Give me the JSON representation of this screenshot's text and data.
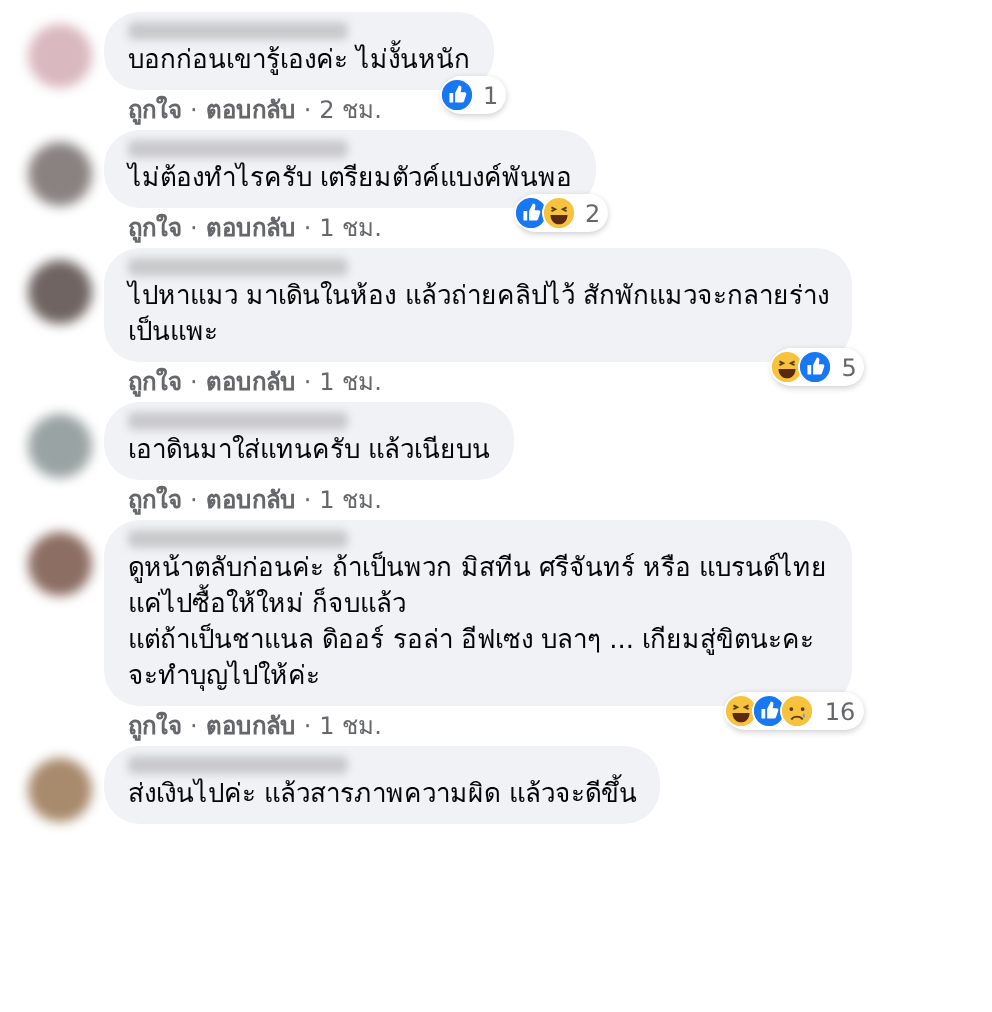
{
  "separator": "·",
  "comments": [
    {
      "avatar": {
        "color": "#d9b8bf"
      },
      "text": "บอกก่อนเขารู้เองค่ะ ไม่งั้นหนัก",
      "reactions": {
        "items": [
          {
            "kind": "like"
          }
        ],
        "count": "1"
      },
      "actions": {
        "like": "ถูกใจ",
        "reply": "ตอบกลับ",
        "time": "2 ชม."
      }
    },
    {
      "avatar": {
        "color": "#8a8280"
      },
      "text": "ไม่ต้องทำไรครับ เตรียมตัวค์แบงค์พันพอ",
      "reactions": {
        "items": [
          {
            "kind": "like"
          },
          {
            "kind": "haha"
          }
        ],
        "count": "2"
      },
      "actions": {
        "like": "ถูกใจ",
        "reply": "ตอบกลับ",
        "time": "1 ชม."
      }
    },
    {
      "avatar": {
        "color": "#6f6462"
      },
      "text": "ไปหาแมว มาเดินในห้อง แล้วถ่ายคลิปไว้ สักพักแมวจะกลายร่าง\nเป็นแพะ",
      "reactions": {
        "items": [
          {
            "kind": "haha"
          },
          {
            "kind": "like"
          }
        ],
        "count": "5"
      },
      "actions": {
        "like": "ถูกใจ",
        "reply": "ตอบกลับ",
        "time": "1 ชม."
      }
    },
    {
      "avatar": {
        "color": "#9aa3a3"
      },
      "text": "เอาดินมาใส่แทนครับ แล้วเนียบน",
      "actions": {
        "like": "ถูกใจ",
        "reply": "ตอบกลับ",
        "time": "1 ชม."
      }
    },
    {
      "avatar": {
        "color": "#8c6e63"
      },
      "text": "ดูหน้าตลับก่อนค่ะ ถ้าเป็นพวก มิสทีน ศรีจันทร์ หรือ แบรนด์ไทย\nแค่ไปซื้อให้ใหม่ ก็จบแล้ว\nแต่ถ้าเป็นชาแนล ดิออร์ รอล่า อีฟเซง บลาๆ ... เกียมสู่ขิตนะคะ\nจะทำบุญไปให้ค่ะ",
      "reactions": {
        "items": [
          {
            "kind": "haha"
          },
          {
            "kind": "like"
          },
          {
            "kind": "sad"
          }
        ],
        "count": "16"
      },
      "actions": {
        "like": "ถูกใจ",
        "reply": "ตอบกลับ",
        "time": "1 ชม."
      }
    },
    {
      "avatar": {
        "color": "#a88a6c"
      },
      "text": "ส่งเงินไปค่ะ แล้วสารภาพความผิด แล้วจะดีขึ้น"
    }
  ]
}
